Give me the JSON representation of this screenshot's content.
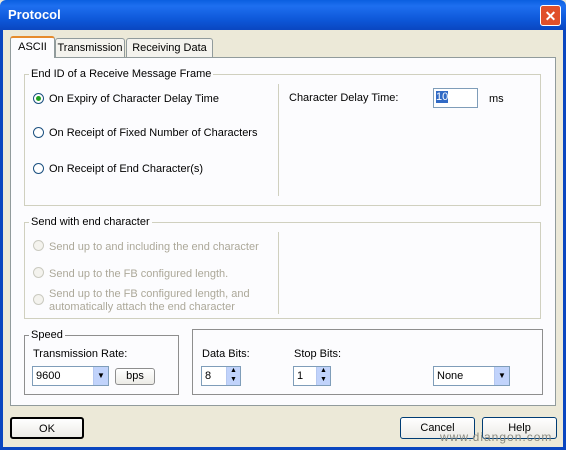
{
  "window": {
    "title": "Protocol",
    "close_glyph": "✕"
  },
  "tabs": [
    {
      "label": "ASCII",
      "active": true
    },
    {
      "label": "Transmission",
      "active": false
    },
    {
      "label": "Receiving Data",
      "active": false
    }
  ],
  "end_id": {
    "group_label": "End ID of a Receive Message Frame",
    "options": [
      {
        "label": "On Expiry of Character Delay Time",
        "checked": true
      },
      {
        "label": "On Receipt of Fixed Number of Characters",
        "checked": false
      },
      {
        "label": "On Receipt of End Character(s)",
        "checked": false
      }
    ],
    "delay_label": "Character Delay Time:",
    "delay_value": "10",
    "delay_unit": "ms"
  },
  "send_end": {
    "group_label": "Send with end character",
    "options": [
      {
        "label": "Send up to and including the end character"
      },
      {
        "label": "Send up to the FB configured length."
      },
      {
        "label_line1": "Send up to the FB configured length, and",
        "label_line2": "automatically attach the end character"
      }
    ]
  },
  "speed": {
    "group_label": "Speed",
    "rate_label": "Transmission Rate:",
    "rate_value": "9600",
    "unit_button": "bps"
  },
  "format": {
    "data_bits_label": "Data Bits:",
    "data_bits_value": "8",
    "stop_bits_label": "Stop Bits:",
    "stop_bits_value": "1",
    "parity_value": "None"
  },
  "footer": {
    "ok": "OK",
    "cancel": "Cancel",
    "help": "Help",
    "watermark": "www.diangon.com"
  }
}
